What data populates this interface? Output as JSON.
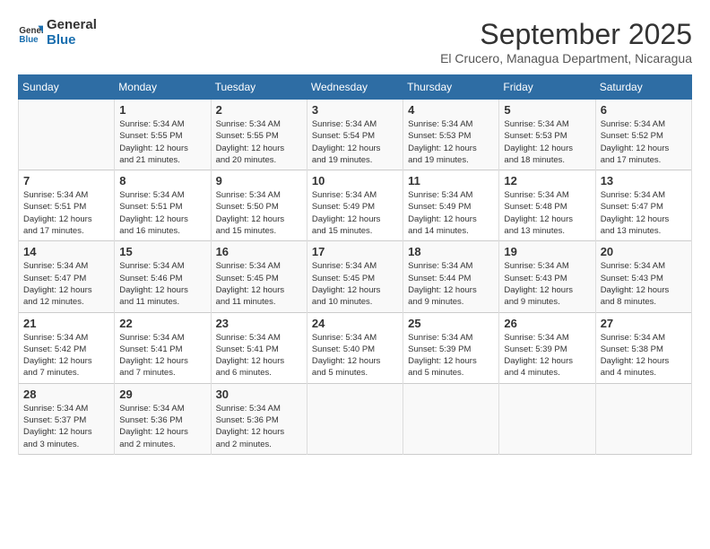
{
  "header": {
    "logo_general": "General",
    "logo_blue": "Blue",
    "month_title": "September 2025",
    "subtitle": "El Crucero, Managua Department, Nicaragua"
  },
  "days_of_week": [
    "Sunday",
    "Monday",
    "Tuesday",
    "Wednesday",
    "Thursday",
    "Friday",
    "Saturday"
  ],
  "weeks": [
    [
      {
        "day": "",
        "content": ""
      },
      {
        "day": "1",
        "content": "Sunrise: 5:34 AM\nSunset: 5:55 PM\nDaylight: 12 hours\nand 21 minutes."
      },
      {
        "day": "2",
        "content": "Sunrise: 5:34 AM\nSunset: 5:55 PM\nDaylight: 12 hours\nand 20 minutes."
      },
      {
        "day": "3",
        "content": "Sunrise: 5:34 AM\nSunset: 5:54 PM\nDaylight: 12 hours\nand 19 minutes."
      },
      {
        "day": "4",
        "content": "Sunrise: 5:34 AM\nSunset: 5:53 PM\nDaylight: 12 hours\nand 19 minutes."
      },
      {
        "day": "5",
        "content": "Sunrise: 5:34 AM\nSunset: 5:53 PM\nDaylight: 12 hours\nand 18 minutes."
      },
      {
        "day": "6",
        "content": "Sunrise: 5:34 AM\nSunset: 5:52 PM\nDaylight: 12 hours\nand 17 minutes."
      }
    ],
    [
      {
        "day": "7",
        "content": "Sunrise: 5:34 AM\nSunset: 5:51 PM\nDaylight: 12 hours\nand 17 minutes."
      },
      {
        "day": "8",
        "content": "Sunrise: 5:34 AM\nSunset: 5:51 PM\nDaylight: 12 hours\nand 16 minutes."
      },
      {
        "day": "9",
        "content": "Sunrise: 5:34 AM\nSunset: 5:50 PM\nDaylight: 12 hours\nand 15 minutes."
      },
      {
        "day": "10",
        "content": "Sunrise: 5:34 AM\nSunset: 5:49 PM\nDaylight: 12 hours\nand 15 minutes."
      },
      {
        "day": "11",
        "content": "Sunrise: 5:34 AM\nSunset: 5:49 PM\nDaylight: 12 hours\nand 14 minutes."
      },
      {
        "day": "12",
        "content": "Sunrise: 5:34 AM\nSunset: 5:48 PM\nDaylight: 12 hours\nand 13 minutes."
      },
      {
        "day": "13",
        "content": "Sunrise: 5:34 AM\nSunset: 5:47 PM\nDaylight: 12 hours\nand 13 minutes."
      }
    ],
    [
      {
        "day": "14",
        "content": "Sunrise: 5:34 AM\nSunset: 5:47 PM\nDaylight: 12 hours\nand 12 minutes."
      },
      {
        "day": "15",
        "content": "Sunrise: 5:34 AM\nSunset: 5:46 PM\nDaylight: 12 hours\nand 11 minutes."
      },
      {
        "day": "16",
        "content": "Sunrise: 5:34 AM\nSunset: 5:45 PM\nDaylight: 12 hours\nand 11 minutes."
      },
      {
        "day": "17",
        "content": "Sunrise: 5:34 AM\nSunset: 5:45 PM\nDaylight: 12 hours\nand 10 minutes."
      },
      {
        "day": "18",
        "content": "Sunrise: 5:34 AM\nSunset: 5:44 PM\nDaylight: 12 hours\nand 9 minutes."
      },
      {
        "day": "19",
        "content": "Sunrise: 5:34 AM\nSunset: 5:43 PM\nDaylight: 12 hours\nand 9 minutes."
      },
      {
        "day": "20",
        "content": "Sunrise: 5:34 AM\nSunset: 5:43 PM\nDaylight: 12 hours\nand 8 minutes."
      }
    ],
    [
      {
        "day": "21",
        "content": "Sunrise: 5:34 AM\nSunset: 5:42 PM\nDaylight: 12 hours\nand 7 minutes."
      },
      {
        "day": "22",
        "content": "Sunrise: 5:34 AM\nSunset: 5:41 PM\nDaylight: 12 hours\nand 7 minutes."
      },
      {
        "day": "23",
        "content": "Sunrise: 5:34 AM\nSunset: 5:41 PM\nDaylight: 12 hours\nand 6 minutes."
      },
      {
        "day": "24",
        "content": "Sunrise: 5:34 AM\nSunset: 5:40 PM\nDaylight: 12 hours\nand 5 minutes."
      },
      {
        "day": "25",
        "content": "Sunrise: 5:34 AM\nSunset: 5:39 PM\nDaylight: 12 hours\nand 5 minutes."
      },
      {
        "day": "26",
        "content": "Sunrise: 5:34 AM\nSunset: 5:39 PM\nDaylight: 12 hours\nand 4 minutes."
      },
      {
        "day": "27",
        "content": "Sunrise: 5:34 AM\nSunset: 5:38 PM\nDaylight: 12 hours\nand 4 minutes."
      }
    ],
    [
      {
        "day": "28",
        "content": "Sunrise: 5:34 AM\nSunset: 5:37 PM\nDaylight: 12 hours\nand 3 minutes."
      },
      {
        "day": "29",
        "content": "Sunrise: 5:34 AM\nSunset: 5:36 PM\nDaylight: 12 hours\nand 2 minutes."
      },
      {
        "day": "30",
        "content": "Sunrise: 5:34 AM\nSunset: 5:36 PM\nDaylight: 12 hours\nand 2 minutes."
      },
      {
        "day": "",
        "content": ""
      },
      {
        "day": "",
        "content": ""
      },
      {
        "day": "",
        "content": ""
      },
      {
        "day": "",
        "content": ""
      }
    ]
  ]
}
